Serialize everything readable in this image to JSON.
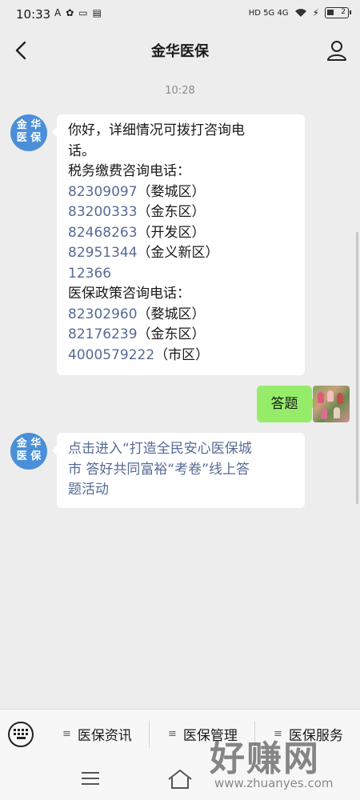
{
  "status_bar": {
    "time": "10:33",
    "left_icons": [
      "A",
      "✿",
      "▭",
      "▤"
    ],
    "network": "HD 5G 4G",
    "battery": "2"
  },
  "header": {
    "title": "金华医保"
  },
  "chat": {
    "timestamp": "10:28",
    "official_avatar": [
      "金 华",
      "医 保"
    ],
    "message1": {
      "intro": [
        "你好，详细情况可拨打咨询电",
        "话。"
      ],
      "tax_heading": "税务缴费咨询电话：",
      "tax_lines": [
        {
          "number": "82309097",
          "area": "（婺城区）"
        },
        {
          "number": "83200333",
          "area": "（金东区）"
        },
        {
          "number": "82468263",
          "area": "（开发区）"
        },
        {
          "number": "82951344",
          "area": "（金义新区）"
        },
        {
          "number": "12366",
          "area": ""
        }
      ],
      "medical_heading": "医保政策咨询电话：",
      "medical_lines": [
        {
          "number": "82302960",
          "area": "（婺城区）"
        },
        {
          "number": "82176239",
          "area": "（金东区）"
        },
        {
          "number": "4000579222",
          "area": "（市区）"
        }
      ]
    },
    "user_message": "答题",
    "message2": [
      "点击进入“打造全民安心医保城",
      "市  答好共同富裕“考卷”线上答",
      "题活动"
    ]
  },
  "bottom_menu": {
    "items": [
      "医保资讯",
      "医保管理",
      "医保服务"
    ]
  },
  "watermark": {
    "text": "好赚网",
    "url": "www.zhuanyes.com"
  },
  "colors": {
    "link": "#576b95",
    "user_bubble": "#95ec69",
    "avatar_blue": "#4a8fd8"
  }
}
